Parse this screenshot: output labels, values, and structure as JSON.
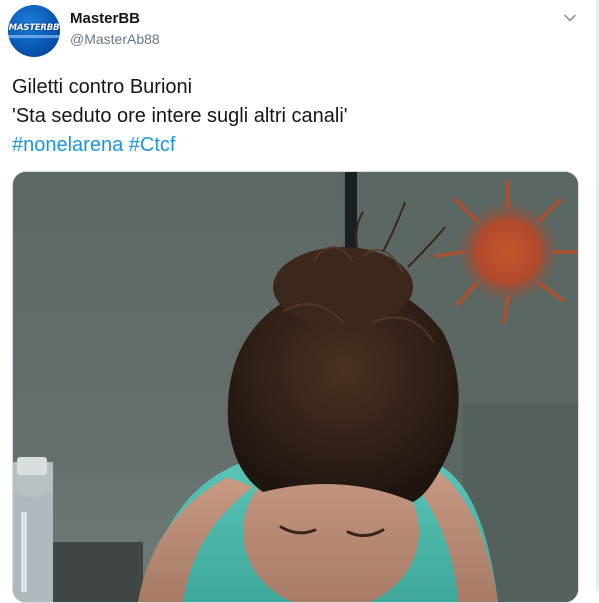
{
  "account": {
    "display_name": "MasterBB",
    "handle": "@MasterAb88",
    "avatar_text": "MASTERBB"
  },
  "tweet": {
    "lines": [
      "Giletti contro Burioni",
      "'Sta seduto ore intere sugli altri canali'"
    ],
    "hashtags": [
      "#nonelarena",
      "#Ctcf"
    ]
  },
  "icons": {
    "menu": "chevron-down-icon"
  },
  "colors": {
    "link": "#1b95e0",
    "text": "#14171a",
    "secondary": "#657786",
    "avatar": "#0a58b4"
  }
}
